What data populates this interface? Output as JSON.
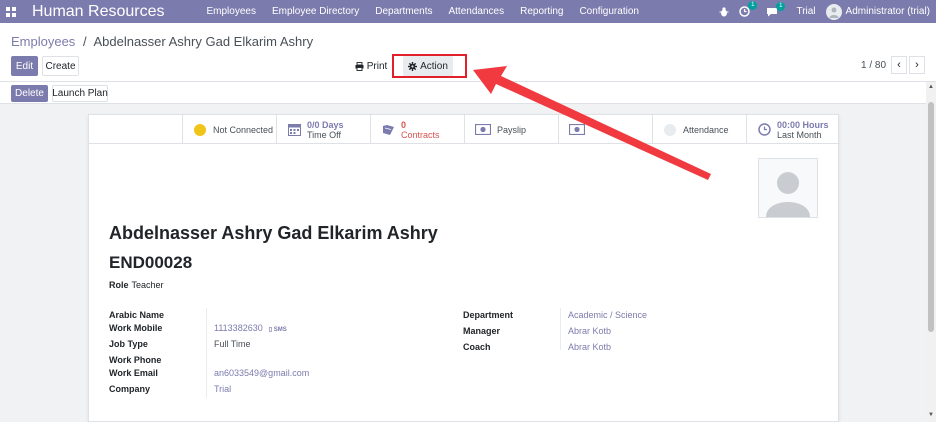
{
  "topbar": {
    "app_title": "Human Resources",
    "menu": [
      "Employees",
      "Employee Directory",
      "Departments",
      "Attendances",
      "Reporting",
      "Configuration"
    ],
    "activity_count": "1",
    "message_count": "1",
    "company": "Trial",
    "user": "Administrator (trial)"
  },
  "control": {
    "breadcrumb_parent": "Employees",
    "breadcrumb_sep": "/",
    "breadcrumb_current": "Abdelnasser Ashry Gad Elkarim Ashry",
    "edit_label": "Edit",
    "create_label": "Create",
    "print_label": "Print",
    "action_label": "Action",
    "pager": "1 / 80",
    "delete_label": "Delete",
    "launch_plan_label": "Launch Plan"
  },
  "smart_buttons": {
    "presence": "Not Connected",
    "timeoff_value": "0/0 Days",
    "timeoff_label": "Time Off",
    "contracts_value": "0",
    "contracts_label": "Contracts",
    "payslip_label": "Payslip",
    "attendance_label": "Attendance",
    "hours_value": "00:00 Hours",
    "hours_label": "Last Month"
  },
  "employee": {
    "name": "Abdelnasser Ashry Gad Elkarim Ashry",
    "code": "END00028",
    "role_label": "Role",
    "role_value": "Teacher"
  },
  "fields_left": {
    "arabic_name_label": "Arabic Name",
    "work_mobile_label": "Work Mobile",
    "work_mobile_value": "1113382630",
    "sms_label": "SMS",
    "job_type_label": "Job Type",
    "job_type_value": "Full Time",
    "work_phone_label": "Work Phone",
    "work_email_label": "Work Email",
    "work_email_value": "an6033549@gmail.com",
    "company_label": "Company",
    "company_value": "Trial"
  },
  "fields_right": {
    "department_label": "Department",
    "department_value": "Academic / Science",
    "manager_label": "Manager",
    "manager_value": "Abrar Kotb",
    "coach_label": "Coach",
    "coach_value": "Abrar Kotb"
  },
  "colors": {
    "brand": "#7c7bad",
    "highlight": "#e0202a",
    "presence_dot": "#f0c419"
  }
}
